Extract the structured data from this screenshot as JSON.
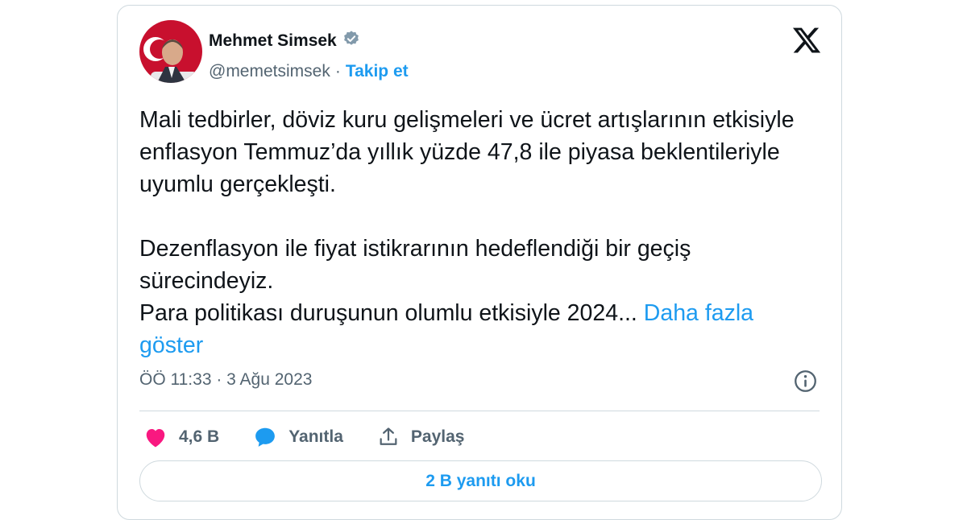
{
  "author": {
    "name": "Mehmet Simsek",
    "handle": "@memetsimsek",
    "separator": "·",
    "follow_label": "Takip et",
    "verified": true
  },
  "tweet": {
    "paragraph1": "Mali tedbirler, döviz kuru gelişmeleri ve ücret artışlarının etkisiyle enflasyon Temmuz’da yıllık yüzde 47,8 ile piyasa beklentileriyle uyumlu gerçekleşti.",
    "paragraph2": "Dezenflasyon ile fiyat istikrarının hedeflendiği bir geçiş sürecindeyiz.",
    "paragraph3": "Para politikası duruşunun olumlu etkisiyle 2024...",
    "show_more": "Daha fazla göster"
  },
  "meta": {
    "timestamp": "ÖÖ 11:33 · 3 Ağu 2023"
  },
  "actions": {
    "likes": "4,6 B",
    "reply_label": "Yanıtla",
    "share_label": "Paylaş"
  },
  "replies_button": "2 B yanıtı oku",
  "icons": {
    "verified": "verified-badge-icon",
    "x_logo": "x-logo-icon",
    "info": "info-icon",
    "heart": "heart-icon",
    "reply": "reply-bubble-icon",
    "share": "share-icon"
  },
  "colors": {
    "accent": "#1d9bf0",
    "heart": "#f91880",
    "secondary_text": "#536471",
    "border": "#cfd9de",
    "verified": "#829aab"
  }
}
